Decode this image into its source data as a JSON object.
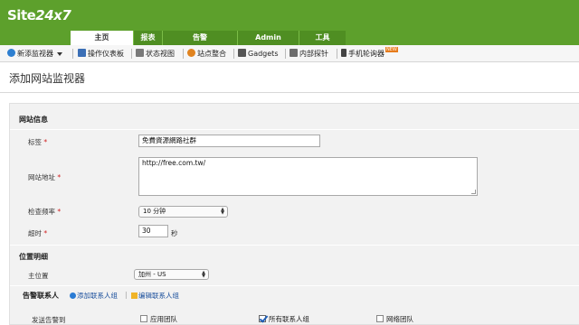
{
  "header": {
    "logo_text": "Site",
    "logo_num": "24x7",
    "tabs": [
      {
        "label": "主页",
        "active": true
      },
      {
        "label": "报表",
        "active": false
      },
      {
        "label": "告警",
        "active": false
      },
      {
        "label": "Admin",
        "active": false
      },
      {
        "label": "工具",
        "active": false
      }
    ]
  },
  "toolbar": {
    "items": [
      {
        "label": "新添监视器",
        "icon": "globe-icon"
      },
      {
        "label": "操作仪表板",
        "icon": "dashboard-icon"
      },
      {
        "label": "状态视图",
        "icon": "grid-icon"
      },
      {
        "label": "站点整合",
        "icon": "puzzle-icon"
      },
      {
        "label": "Gadgets",
        "icon": "gadget-icon"
      },
      {
        "label": "内部探针",
        "icon": "probe-icon"
      },
      {
        "label": "手机轮询器",
        "icon": "phone-icon"
      }
    ],
    "new_badge": "NEW"
  },
  "page": {
    "title": "添加网站监视器"
  },
  "form": {
    "section_site_info": "网站信息",
    "label_name": "标签",
    "name_value": "免費資源網路社群",
    "label_url": "网站地址",
    "url_value": "http://free.com.tw/",
    "label_frequency": "检查频率",
    "frequency_value": "10 分钟",
    "label_timeout": "超时",
    "timeout_value": "30",
    "timeout_unit": "秒",
    "section_locations": "位置明细",
    "label_primary_location": "主位置",
    "primary_location_value": "加州 - US",
    "section_contacts": "告警联系人",
    "add_contact_group": "添加联系人组",
    "edit_contact_group": "编辑联系人组",
    "label_send_alert_to": "发送告警到",
    "contact_groups": [
      {
        "label": "应用团队",
        "checked": false
      },
      {
        "label": "所有联系人组",
        "checked": true
      },
      {
        "label": "网络团队",
        "checked": false
      }
    ],
    "required_mark": "*"
  },
  "colors": {
    "header_green": "#5da02c",
    "link_blue": "#1a4f9c",
    "required_red": "#d01f1f"
  }
}
